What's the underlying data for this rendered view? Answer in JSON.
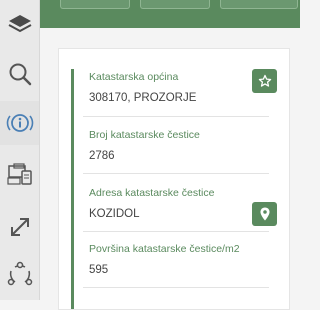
{
  "sidebar": {
    "items": [
      {
        "name": "layers-icon"
      },
      {
        "name": "search-icon"
      },
      {
        "name": "info-icon"
      },
      {
        "name": "devices-icon"
      },
      {
        "name": "expand-icon"
      },
      {
        "name": "share-icon"
      }
    ]
  },
  "parcel": {
    "fields": [
      {
        "label": "Katastarska općina",
        "value": "308170, PROZORJE"
      },
      {
        "label": "Broj katastarske čestice",
        "value": "2786"
      },
      {
        "label": "Adresa katastarske čestice",
        "value": "KOZIDOL"
      },
      {
        "label": "Površina katastarske čestice/m2",
        "value": "595"
      }
    ]
  },
  "colors": {
    "accent": "#5a8a5e",
    "info_icon": "#4a7fb5",
    "icon_gray": "#555555"
  }
}
